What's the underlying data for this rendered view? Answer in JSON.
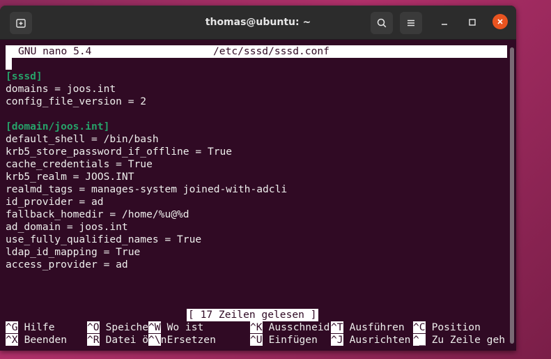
{
  "window": {
    "title": "thomas@ubuntu: ~"
  },
  "nano": {
    "version": "GNU nano 5.4",
    "file": "/etc/sssd/sssd.conf",
    "status": "[ 17 Zeilen gelesen ]",
    "lines": [
      {
        "text": "[sssd]",
        "type": "section"
      },
      {
        "text": "domains = joos.int",
        "type": "plain"
      },
      {
        "text": "config_file_version = 2",
        "type": "plain"
      },
      {
        "text": "",
        "type": "plain"
      },
      {
        "text": "[domain/joos.int]",
        "type": "section"
      },
      {
        "text": "default_shell = /bin/bash",
        "type": "plain"
      },
      {
        "text": "krb5_store_password_if_offline = True",
        "type": "plain"
      },
      {
        "text": "cache_credentials = True",
        "type": "plain"
      },
      {
        "text": "krb5_realm = JOOS.INT",
        "type": "plain"
      },
      {
        "text": "realmd_tags = manages-system joined-with-adcli",
        "type": "plain"
      },
      {
        "text": "id_provider = ad",
        "type": "plain"
      },
      {
        "text": "fallback_homedir = /home/%u@%d",
        "type": "plain"
      },
      {
        "text": "ad_domain = joos.int",
        "type": "plain"
      },
      {
        "text": "use_fully_qualified_names = True",
        "type": "plain"
      },
      {
        "text": "ldap_id_mapping = True",
        "type": "plain"
      },
      {
        "text": "access_provider = ad",
        "type": "plain"
      }
    ],
    "shortcuts_row1": [
      {
        "key": "^G",
        "label": "Hilfe"
      },
      {
        "key": "^O",
        "label": "Speichern"
      },
      {
        "key": "^W",
        "label": "Wo ist"
      },
      {
        "key": "^K",
        "label": "Ausschneid"
      },
      {
        "key": "^T",
        "label": "Ausführen"
      },
      {
        "key": "^C",
        "label": "Position"
      }
    ],
    "shortcuts_row2": [
      {
        "key": "^X",
        "label": "Beenden"
      },
      {
        "key": "^R",
        "label": "Datei öffn"
      },
      {
        "key": "^\\",
        "label": "Ersetzen"
      },
      {
        "key": "^U",
        "label": "Einfügen"
      },
      {
        "key": "^J",
        "label": "Ausrichten"
      },
      {
        "key": "^_",
        "label": "Zu Zeile geh"
      }
    ]
  },
  "colors": {
    "terminal_bg": "#300a24",
    "section": "#26a269",
    "close": "#e95420"
  }
}
